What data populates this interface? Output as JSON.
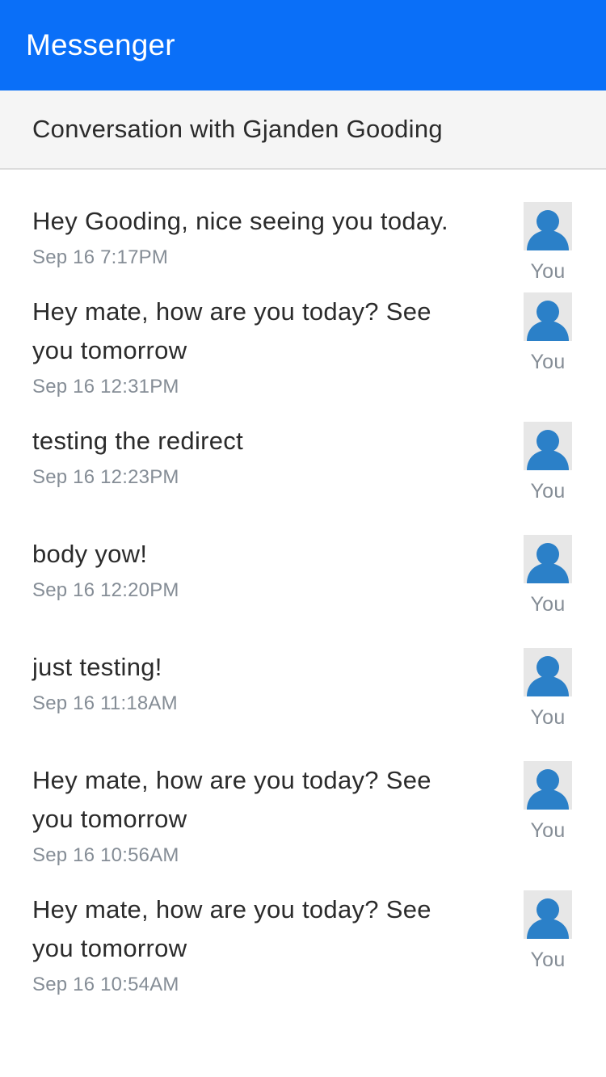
{
  "header": {
    "title": "Messenger"
  },
  "conversation": {
    "title": "Conversation with Gjanden Gooding"
  },
  "colors": {
    "header_bg": "#0a6ff8",
    "avatar_fg": "#2b80c8",
    "avatar_bg": "#e7e7e7"
  },
  "messages": [
    {
      "text": "Hey Gooding, nice seeing you today.",
      "time": "Sep 16 7:17PM",
      "sender": "You",
      "avatar_icon": "person-icon"
    },
    {
      "text": "Hey mate, how are you today? See you tomorrow",
      "time": "Sep 16 12:31PM",
      "sender": "You",
      "avatar_icon": "person-icon"
    },
    {
      "text": "testing the redirect",
      "time": "Sep 16 12:23PM",
      "sender": "You",
      "avatar_icon": "person-icon"
    },
    {
      "text": "body yow!",
      "time": "Sep 16 12:20PM",
      "sender": "You",
      "avatar_icon": "person-icon"
    },
    {
      "text": "just testing!",
      "time": "Sep 16 11:18AM",
      "sender": "You",
      "avatar_icon": "person-icon"
    },
    {
      "text": "Hey mate, how are you today? See you tomorrow",
      "time": "Sep 16 10:56AM",
      "sender": "You",
      "avatar_icon": "person-icon"
    },
    {
      "text": "Hey mate, how are you today? See you tomorrow",
      "time": "Sep 16 10:54AM",
      "sender": "You",
      "avatar_icon": "person-icon"
    }
  ]
}
